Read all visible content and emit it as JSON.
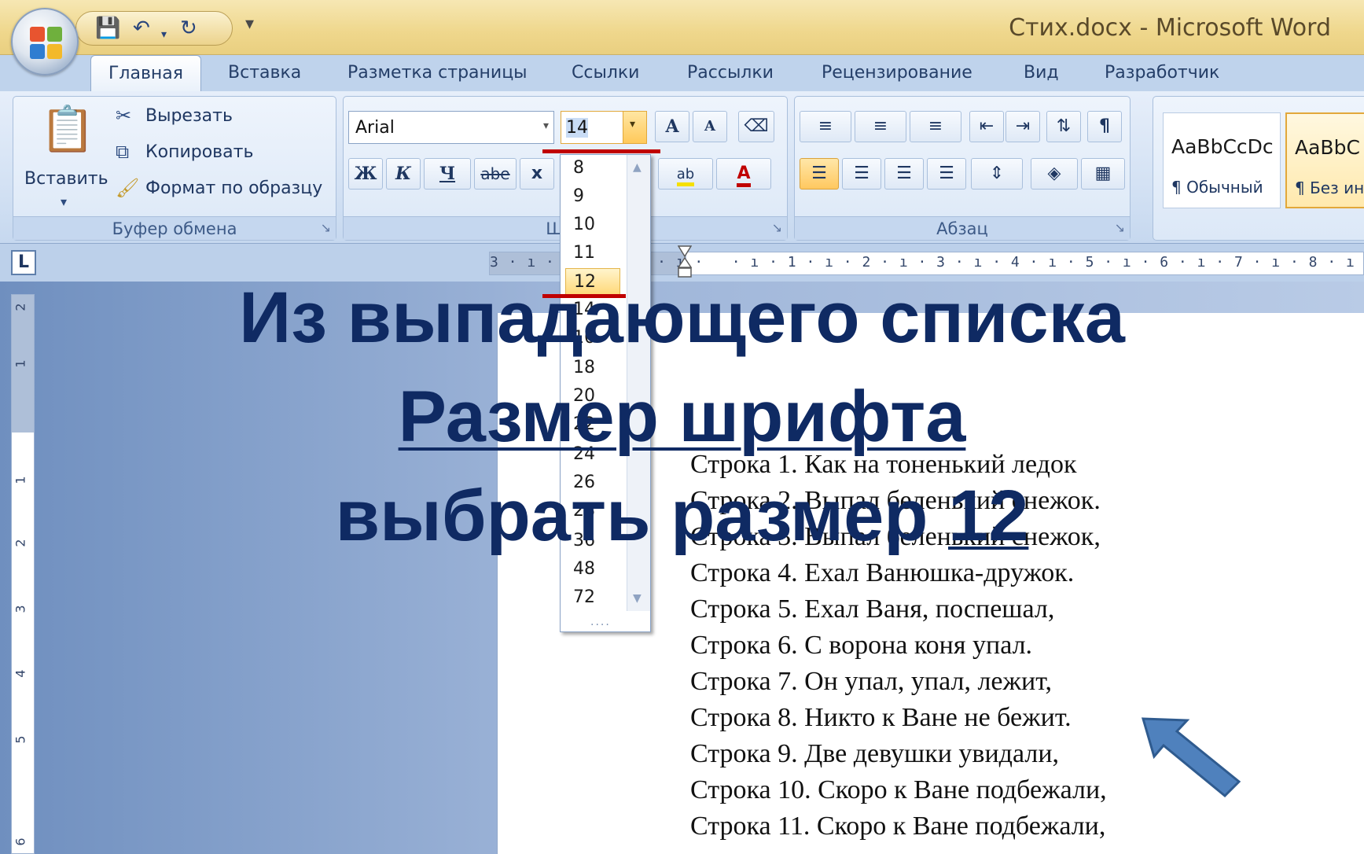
{
  "window": {
    "title": "Стих.docx - Microsoft Word",
    "quick_access": [
      "save-icon",
      "undo-icon",
      "redo-icon",
      "customize-icon"
    ]
  },
  "tabs": [
    "Главная",
    "Вставка",
    "Разметка страницы",
    "Ссылки",
    "Рассылки",
    "Рецензирование",
    "Вид",
    "Разработчик"
  ],
  "active_tab": "Главная",
  "clipboard": {
    "paste_label": "Вставить",
    "cut_label": "Вырезать",
    "copy_label": "Копировать",
    "format_painter_label": "Формат по образцу",
    "group_label": "Буфер обмена"
  },
  "font": {
    "name_value": "Arial",
    "size_value": "14",
    "group_label": "Шри",
    "bold_label": "Ж",
    "italic_label": "К",
    "underline_label": "Ч",
    "strike_label": "abe",
    "subscript_label": "x",
    "grow_label": "A",
    "shrink_label": "A",
    "highlight_label": "ab",
    "color_label": "A"
  },
  "font_size_dropdown": {
    "items": [
      "8",
      "9",
      "10",
      "11",
      "12",
      "14",
      "16",
      "18",
      "20",
      "22",
      "24",
      "26",
      "28",
      "36",
      "48",
      "72"
    ],
    "highlighted": "12",
    "grip": "....",
    "scroll_up_icon": "chevron-up-icon",
    "scroll_down_icon": "chevron-down-icon"
  },
  "paragraph": {
    "group_label": "Абзац",
    "pilcrow": "¶"
  },
  "styles": {
    "items": [
      {
        "preview": "AaBbCcDc",
        "name": "¶ Обычный"
      },
      {
        "preview": "AaBbC",
        "name": "¶ Без ин"
      }
    ]
  },
  "ruler": {
    "tab_selector": "L",
    "marks": "3 · ı · 2 · ı · 1 · ı ·   · ı · 1 · ı · 2 · ı · 3 · ı · 4 · ı · 5 · ı · 6 · ı · 7 · ı · 8 · ı · 9 · ı ·10 ·",
    "vertical_marks": [
      "2",
      "1",
      "1",
      "2",
      "3",
      "4",
      "5",
      "6"
    ]
  },
  "document": {
    "lines": [
      "Строка 1. Как на тоненький ледок",
      "Строка 2. Выпал беленький снежок.",
      "Строка 3. Выпал беленький снежок,",
      "Строка 4. Ехал  Ванюшка-дружок.",
      "Строка 5. Ехал Ваня, поспешал,",
      "Строка 6. С ворона коня упал.",
      "Строка 7. Он упал, упал, лежит,",
      "Строка 8. Никто к Ване не бежит.",
      "Строка 9. Две девушки увидали,",
      "Строка 10. Скоро к Ване подбежали,",
      "Строка 11. Скоро к Ване подбежали,"
    ]
  },
  "instruction": {
    "line1": "Из выпадающего списка",
    "line2": "Размер шрифта",
    "line3_prefix": "выбрать размер ",
    "line3_value": "12"
  },
  "colors": {
    "overlay_text": "#0f2a63",
    "red_mark": "#c00000",
    "arrow": "#4f81bd"
  }
}
